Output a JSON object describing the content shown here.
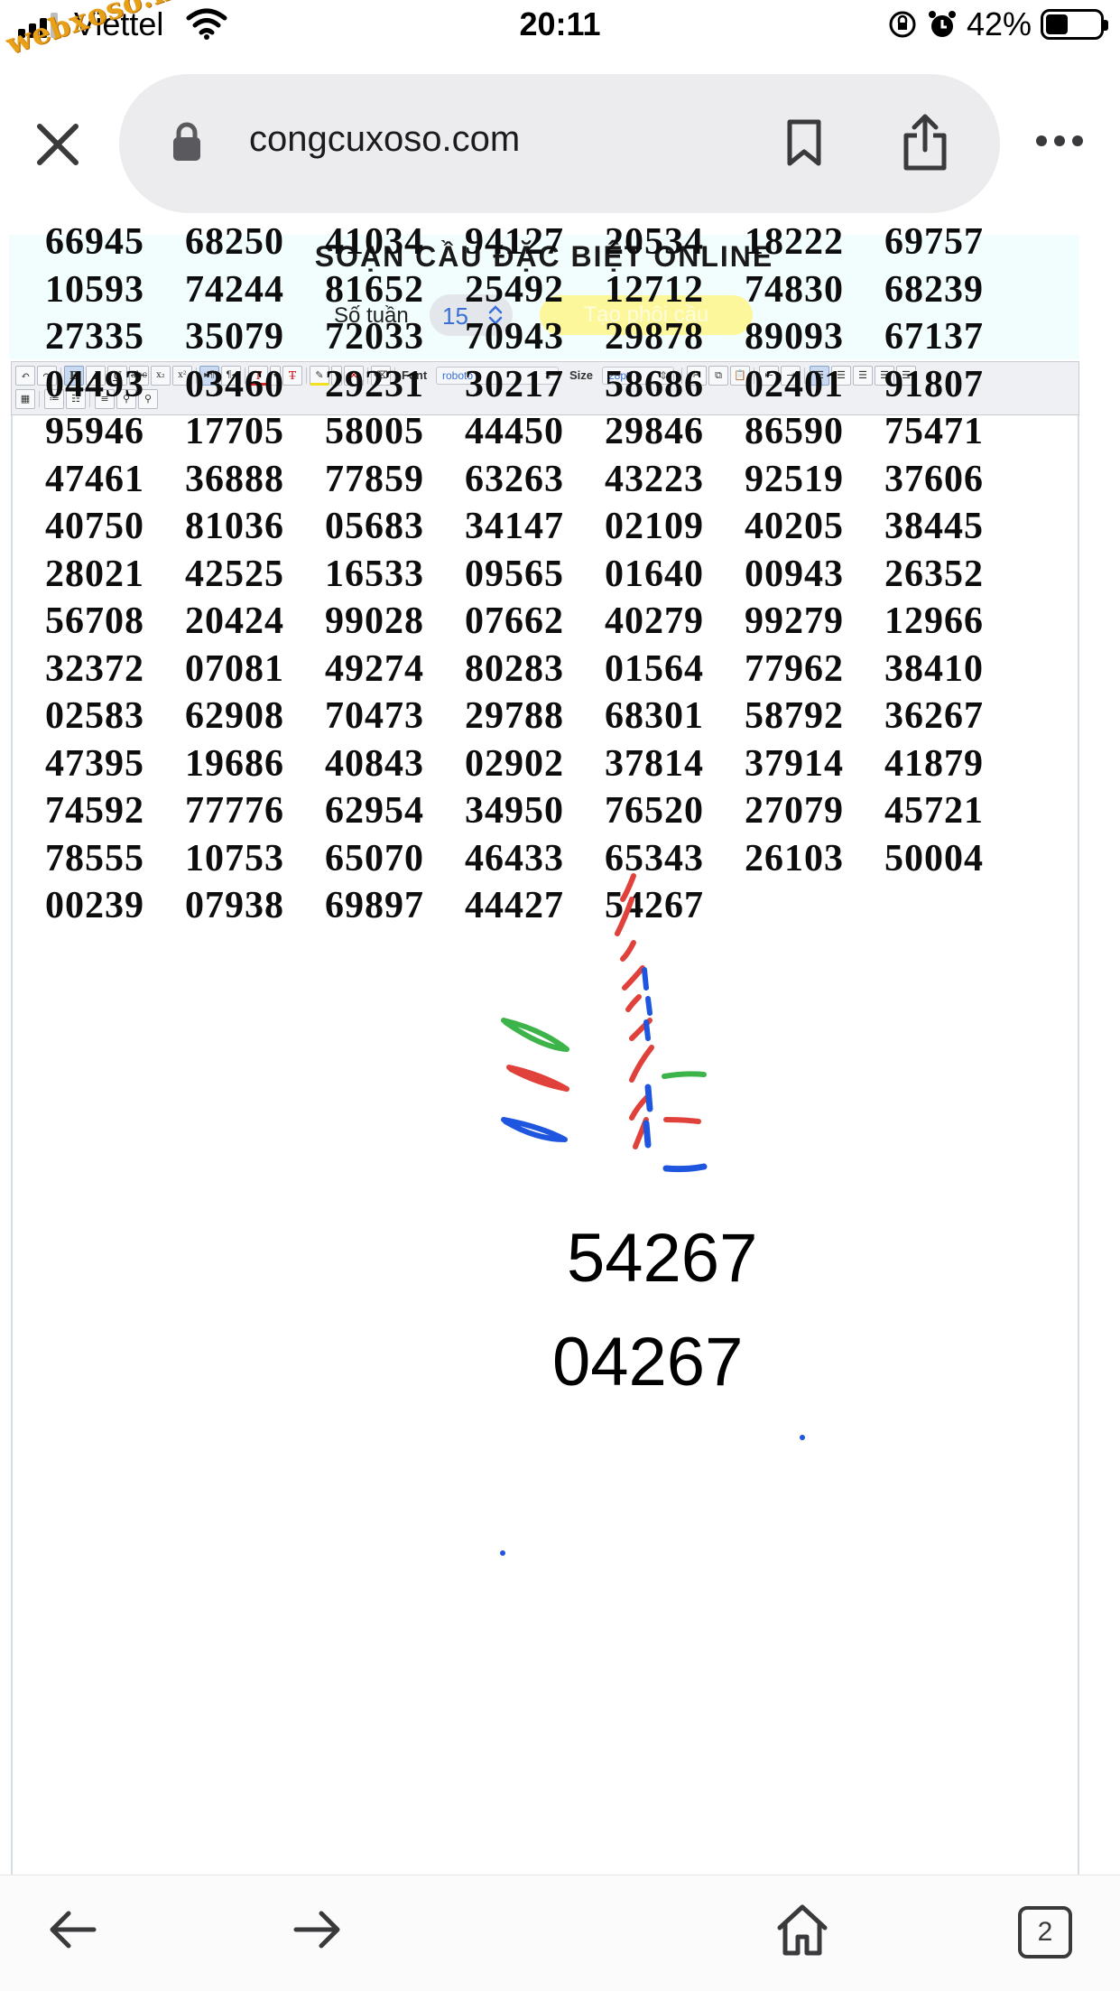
{
  "status_bar": {
    "carrier": "Viettel",
    "watermark": "webxoso.net",
    "time": "20:11",
    "battery_percent": "42%",
    "battery_level": 0.42
  },
  "browser": {
    "url": "congcuxoso.com",
    "open_tabs": "2"
  },
  "page": {
    "title": "SOẠN CẦU ĐẶC BIỆT ONLINE",
    "weeks_label": "Số tuần",
    "weeks_value": "15",
    "generate_button": "Tạo phôi cầu"
  },
  "toolbar": {
    "font_label": "Font",
    "font_value": "roboto",
    "size_label": "Size",
    "size_value": "28pt"
  },
  "numbers": [
    [
      "66945",
      "68250",
      "41034",
      "94127",
      "20534",
      "18222",
      "69757"
    ],
    [
      "10593",
      "74244",
      "81652",
      "25492",
      "12712",
      "74830",
      "68239"
    ],
    [
      "27335",
      "35079",
      "72033",
      "70943",
      "29878",
      "89093",
      "67137"
    ],
    [
      "04493",
      "03460",
      "29231",
      "30217",
      "58686",
      "02401",
      "91807"
    ],
    [
      "95946",
      "17705",
      "58005",
      "44450",
      "29846",
      "86590",
      "75471"
    ],
    [
      "47461",
      "36888",
      "77859",
      "63263",
      "43223",
      "92519",
      "37606"
    ],
    [
      "40750",
      "81036",
      "05683",
      "34147",
      "02109",
      "40205",
      "38445"
    ],
    [
      "28021",
      "42525",
      "16533",
      "09565",
      "01640",
      "00943",
      "26352"
    ],
    [
      "56708",
      "20424",
      "99028",
      "07662",
      "40279",
      "99279",
      "12966"
    ],
    [
      "32372",
      "07081",
      "49274",
      "80283",
      "01564",
      "77962",
      "38410"
    ],
    [
      "02583",
      "62908",
      "70473",
      "29788",
      "68301",
      "58792",
      "36267"
    ],
    [
      "47395",
      "19686",
      "40843",
      "02902",
      "37814",
      "37914",
      "41879"
    ],
    [
      "74592",
      "77776",
      "62954",
      "34950",
      "76520",
      "27079",
      "45721"
    ],
    [
      "78555",
      "10753",
      "65070",
      "46433",
      "65343",
      "26103",
      "50004"
    ],
    [
      "00239",
      "07938",
      "69897",
      "44427",
      "54267"
    ]
  ],
  "results": {
    "line1": "54267",
    "line2": "04267"
  },
  "colors": {
    "annotation_red": "#e0413a",
    "annotation_blue": "#1f56e0",
    "annotation_green": "#3cb44a",
    "watermark": "#e8a018",
    "header_bg": "#f2fdfd",
    "button_bg": "#fdf79c"
  },
  "icons": {
    "close": "close-icon",
    "lock": "lock-icon",
    "bookmark": "bookmark-icon",
    "share": "share-icon",
    "more": "more-icon",
    "back": "back-arrow-icon",
    "forward": "forward-arrow-icon",
    "home": "home-icon",
    "tabs": "tabs-icon"
  }
}
